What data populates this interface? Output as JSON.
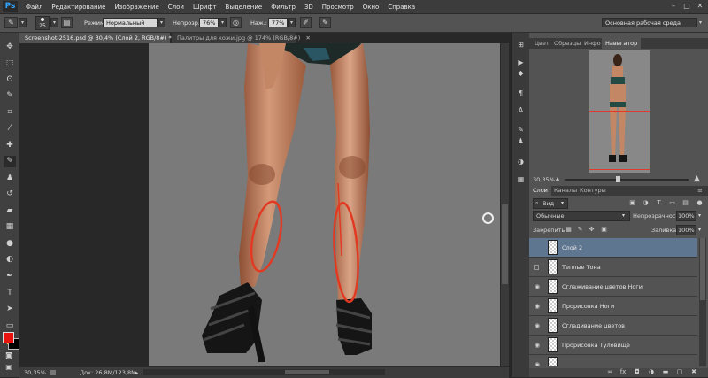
{
  "app": {
    "logo": "Ps"
  },
  "menu": [
    "Файл",
    "Редактирование",
    "Изображение",
    "Слои",
    "Шрифт",
    "Выделение",
    "Фильтр",
    "3D",
    "Просмотр",
    "Окно",
    "Справка"
  ],
  "options": {
    "brush_size": "25",
    "mode_label": "Режим:",
    "mode_value": "Нормальный",
    "opacity_label": "Непрозр.:",
    "opacity_value": "76%",
    "pressure_label": "Наж.:",
    "pressure_value": "77%",
    "workspace": "Основная рабочая среда"
  },
  "tabs": [
    {
      "label": "Screenshot-2516.psd @ 30,4% (Слой 2, RGB/8#) *",
      "active": true
    },
    {
      "label": "Палитры для кожи.jpg @ 174% (RGB/8#)",
      "active": false
    }
  ],
  "status": {
    "zoom": "30,35%",
    "doc": "Док: 26,8M/123,8M"
  },
  "navigator": {
    "tabs": [
      "Цвет",
      "Образцы",
      "Инфо",
      "Навигатор"
    ],
    "active_tab": "Навигатор",
    "zoom": "30,35%"
  },
  "layers_panel": {
    "tabs": [
      "Слои",
      "Каналы",
      "Контуры"
    ],
    "active_tab": "Слои",
    "filter_label": "Вид",
    "blend_mode": "Обычные",
    "opacity_label": "Непрозрачность:",
    "opacity_value": "100%",
    "lock_label": "Закрепить:",
    "fill_label": "Заливка:",
    "fill_value": "100%",
    "layers": [
      {
        "name": "Слой 2",
        "selected": true,
        "visible": false
      },
      {
        "name": "Теплые Тона",
        "selected": false,
        "visible": false
      },
      {
        "name": "Сглаживание цветов Ноги",
        "selected": false,
        "visible": true
      },
      {
        "name": "Прорисовка Ноги",
        "selected": false,
        "visible": true
      },
      {
        "name": "Сгладивание цветов",
        "selected": false,
        "visible": true
      },
      {
        "name": "Прорисовка Туловище",
        "selected": false,
        "visible": true
      }
    ]
  },
  "colors": {
    "foreground": "#e8130f",
    "background": "#000000",
    "annotation": "#e23a22",
    "skin": "#c98a68"
  },
  "icons": {
    "toolbox": [
      "move-icon",
      "marquee-icon",
      "lasso-icon",
      "quick-select-icon",
      "crop-icon",
      "eyedropper-icon",
      "healing-icon",
      "brush-icon",
      "stamp-icon",
      "history-brush-icon",
      "eraser-icon",
      "gradient-icon",
      "blur-icon",
      "dodge-icon",
      "pen-icon",
      "type-icon",
      "path-select-icon",
      "shape-icon",
      "hand-icon",
      "zoom-icon"
    ]
  }
}
